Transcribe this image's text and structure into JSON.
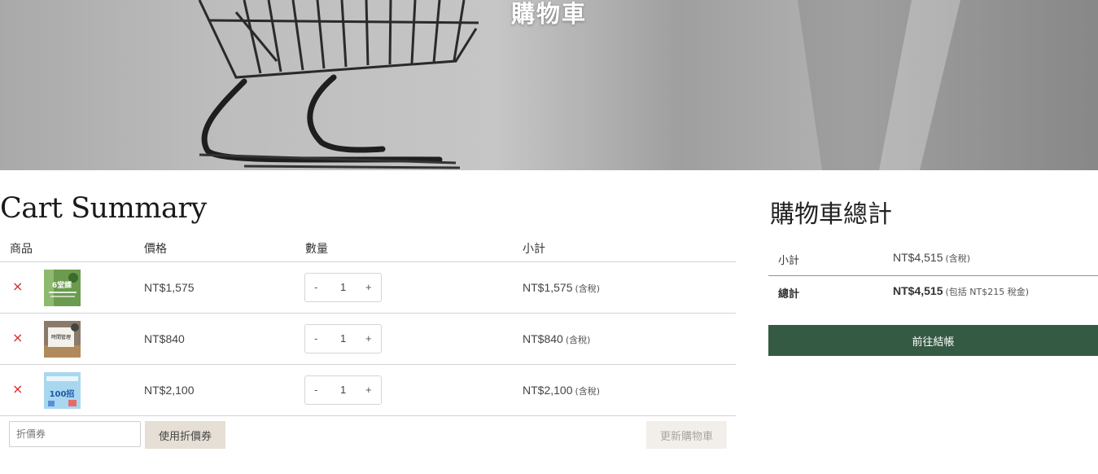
{
  "hero": {
    "title": "購物車"
  },
  "cart": {
    "heading": "Cart Summary",
    "columns": {
      "product": "商品",
      "price": "價格",
      "quantity": "數量",
      "subtotal": "小計"
    },
    "remove_symbol": "×",
    "qty_minus": "-",
    "qty_plus": "+",
    "items": [
      {
        "price": "NT$1,575",
        "qty": "1",
        "subtotal": "NT$1,575",
        "tax_note": "(含稅)",
        "thumb_text": "6堂課",
        "thumb_color": "#6a9b4e"
      },
      {
        "price": "NT$840",
        "qty": "1",
        "subtotal": "NT$840",
        "tax_note": "(含稅)",
        "thumb_text": "時間管理",
        "thumb_color": "#8a7a6a"
      },
      {
        "price": "NT$2,100",
        "qty": "1",
        "subtotal": "NT$2,100",
        "tax_note": "(含稅)",
        "thumb_text": "100招",
        "thumb_color": "#a9d7ef"
      }
    ],
    "coupon_placeholder": "折價券",
    "apply_coupon": "使用折價券",
    "update_cart": "更新購物車"
  },
  "totals": {
    "heading": "購物車總計",
    "subtotal_label": "小計",
    "subtotal_value": "NT$4,515",
    "subtotal_note": "(含稅)",
    "total_label": "總計",
    "total_value": "NT$4,515",
    "total_note": "(包括 NT$215 稅金)",
    "checkout": "前往結帳"
  },
  "colors": {
    "checkout_green": "#355a43",
    "remove_red": "#d62a2a",
    "coupon_button": "#e6dfd5"
  }
}
